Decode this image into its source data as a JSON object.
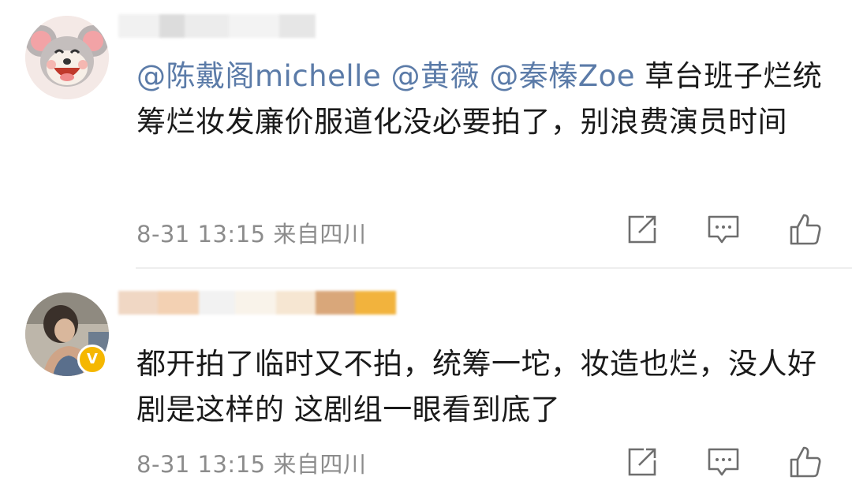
{
  "comments": [
    {
      "mentions": [
        "@陈戴阁michelle",
        "@黄薇",
        "@秦榛Zoe"
      ],
      "text": "草台班子烂统筹烂妆发廉价服道化没必要拍了，别浪费演员时间",
      "timestamp": "8-31 13:15",
      "location": "来自四川",
      "avatar_icon": "cartoon-mouse-avatar",
      "verified": false
    },
    {
      "mentions": [],
      "text": "都开拍了临时又不拍，统筹一坨，妆造也烂，没人好剧是这样的 这剧组一眼看到底了",
      "timestamp": "8-31 13:15",
      "location": "来自四川",
      "avatar_icon": "photo-avatar",
      "verified": true,
      "verified_badge": "V"
    }
  ],
  "actions": {
    "share_icon": "share-icon",
    "comment_icon": "comment-icon",
    "like_icon": "thumbs-up-icon"
  },
  "colors": {
    "mention": "#5b7ba8",
    "meta": "#8c8c8c",
    "icon": "#6e6e6e",
    "verified_badge": "#f5b700"
  }
}
